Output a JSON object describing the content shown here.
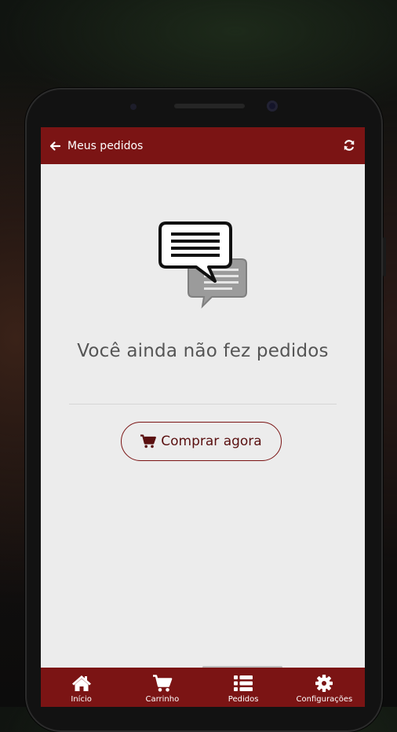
{
  "colors": {
    "brand": "#7b1414",
    "screen_bg": "#ececec",
    "text_muted": "#555555"
  },
  "appbar": {
    "title": "Meus pedidos",
    "back_icon": "arrow-left-icon",
    "refresh_icon": "refresh-icon"
  },
  "empty_state": {
    "icon": "chat-bubbles-icon",
    "message": "Você ainda não fez pedidos",
    "button_label": "Comprar agora",
    "button_icon": "shopping-cart-icon"
  },
  "bottom_nav": {
    "items": [
      {
        "label": "Início",
        "icon": "home-icon"
      },
      {
        "label": "Carrinho",
        "icon": "shopping-cart-icon"
      },
      {
        "label": "Pedidos",
        "icon": "list-icon"
      },
      {
        "label": "Configurações",
        "icon": "gear-icon"
      }
    ]
  }
}
